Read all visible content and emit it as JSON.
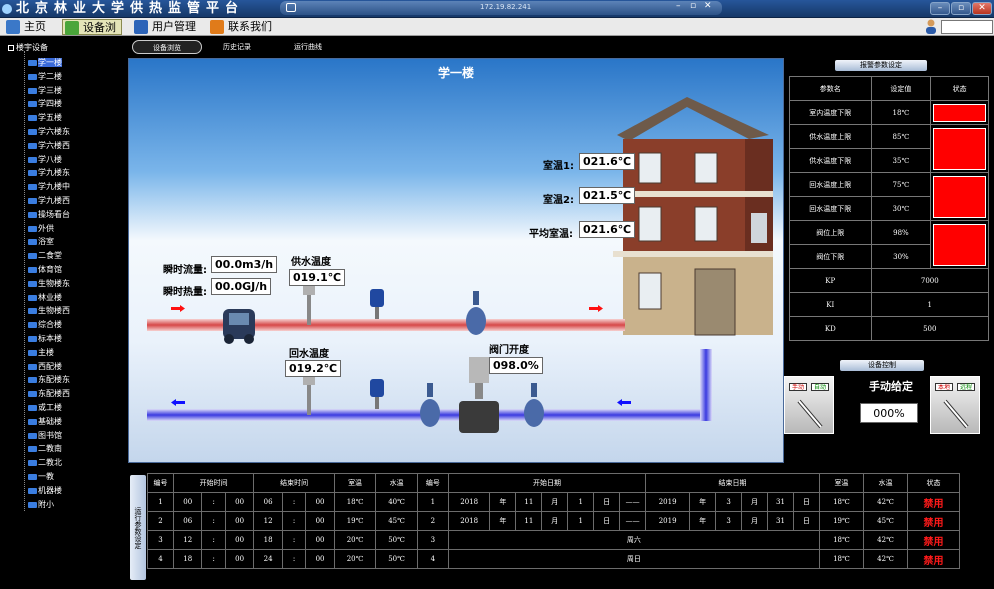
{
  "app": {
    "title": "北京林业大学供热监管平台",
    "ip": "172.19.82.241",
    "win_min": "–",
    "win_max": "▫",
    "win_close": "✕"
  },
  "menu": [
    {
      "label": "主页",
      "icon": "home-icon",
      "color": "#3b78c8"
    },
    {
      "label": "设备浏览",
      "icon": "gear-icon",
      "color": "#4aa53a"
    },
    {
      "label": "用户管理",
      "icon": "user-icon",
      "color": "#2d64b8"
    },
    {
      "label": "联系我们",
      "icon": "contact-icon",
      "color": "#e07b1a"
    }
  ],
  "tree": {
    "root": "楼宇设备",
    "items": [
      "学一楼",
      "学二楼",
      "学三楼",
      "学四楼",
      "学五楼",
      "学六楼东",
      "学六楼西",
      "学八楼",
      "学九楼东",
      "学九楼中",
      "学九楼西",
      "操场看台",
      "外供",
      "浴室",
      "二食堂",
      "体育馆",
      "生物楼东",
      "林业楼",
      "生物楼西",
      "综合楼",
      "标本楼",
      "主楼",
      "西配楼",
      "东配楼东",
      "东配楼西",
      "或工楼",
      "基础楼",
      "图书馆",
      "二教南",
      "二教北",
      "一教",
      "机器楼",
      "附小"
    ],
    "selected": 0
  },
  "view_tabs": [
    "设备浏览",
    "历史记录",
    "运行曲线"
  ],
  "scene": {
    "title": "学一楼",
    "room1_label": "室温1:",
    "room1_value": "021.6℃",
    "room2_label": "室温2:",
    "room2_value": "021.5℃",
    "avg_label": "平均室温:",
    "avg_value": "021.6℃",
    "flow_label": "瞬时流量:",
    "flow_value": "00.0m3/h",
    "heat_label": "瞬时热量:",
    "heat_value": "00.0GJ/h",
    "supply_label": "供水温度",
    "supply_value": "019.1℃",
    "return_label": "回水温度",
    "return_value": "019.2℃",
    "valve_label": "阀门开度",
    "valve_value": "098.0%"
  },
  "alarm": {
    "tab": "报警参数设定",
    "headers": [
      "参数名",
      "设定值",
      "状态"
    ],
    "rows": [
      {
        "name": "室内温度下限",
        "value": "18℃"
      },
      {
        "name": "供水温度上限",
        "value": "85℃"
      },
      {
        "name": "供水温度下限",
        "value": "35℃"
      },
      {
        "name": "回水温度上限",
        "value": "75℃"
      },
      {
        "name": "回水温度下限",
        "value": "30℃"
      },
      {
        "name": "阀位上限",
        "value": "98%"
      },
      {
        "name": "阀位下限",
        "value": "30%"
      }
    ],
    "pid": [
      {
        "name": "KP",
        "value": "7000"
      },
      {
        "name": "KI",
        "value": "1"
      },
      {
        "name": "KD",
        "value": "500"
      }
    ]
  },
  "control": {
    "tab": "设备控制",
    "left_btn1": "手动",
    "left_btn2": "自动",
    "right_btn1": "本地",
    "right_btn2": "远程",
    "manual_label": "手动给定",
    "manual_value": "000%"
  },
  "schedule": {
    "side_label": "运行参数设定",
    "headers": [
      "编号",
      "开始时间",
      "结束时间",
      "室温",
      "水温",
      "编号",
      "开始日期",
      "",
      "结束日期",
      "室温",
      "水温",
      "状态"
    ],
    "time_rows": [
      {
        "no": "1",
        "sh": "00",
        "sm": "00",
        "eh": "06",
        "em": "00",
        "room": "18℃",
        "water": "40℃"
      },
      {
        "no": "2",
        "sh": "06",
        "sm": "00",
        "eh": "12",
        "em": "00",
        "room": "19℃",
        "water": "45℃"
      },
      {
        "no": "3",
        "sh": "12",
        "sm": "00",
        "eh": "18",
        "em": "00",
        "room": "20℃",
        "water": "50℃"
      },
      {
        "no": "4",
        "sh": "18",
        "sm": "00",
        "eh": "24",
        "em": "00",
        "room": "20℃",
        "water": "50℃"
      }
    ],
    "colon": ":",
    "date_rows": [
      {
        "no": "1",
        "sy": "2018",
        "sm": "11",
        "sd": "1",
        "sep": "——",
        "ey": "2019",
        "em": "3",
        "ed": "31",
        "room": "18℃",
        "water": "42℃",
        "status": "禁用"
      },
      {
        "no": "2",
        "sy": "2018",
        "sm": "11",
        "sd": "1",
        "sep": "——",
        "ey": "2019",
        "em": "3",
        "ed": "31",
        "room": "19℃",
        "water": "45℃",
        "status": "禁用"
      },
      {
        "no": "3",
        "text": "周六",
        "room": "18℃",
        "water": "42℃",
        "status": "禁用"
      },
      {
        "no": "4",
        "text": "周日",
        "room": "18℃",
        "water": "42℃",
        "status": "禁用"
      }
    ],
    "y_unit": "年",
    "m_unit": "月",
    "d_unit": "日"
  }
}
